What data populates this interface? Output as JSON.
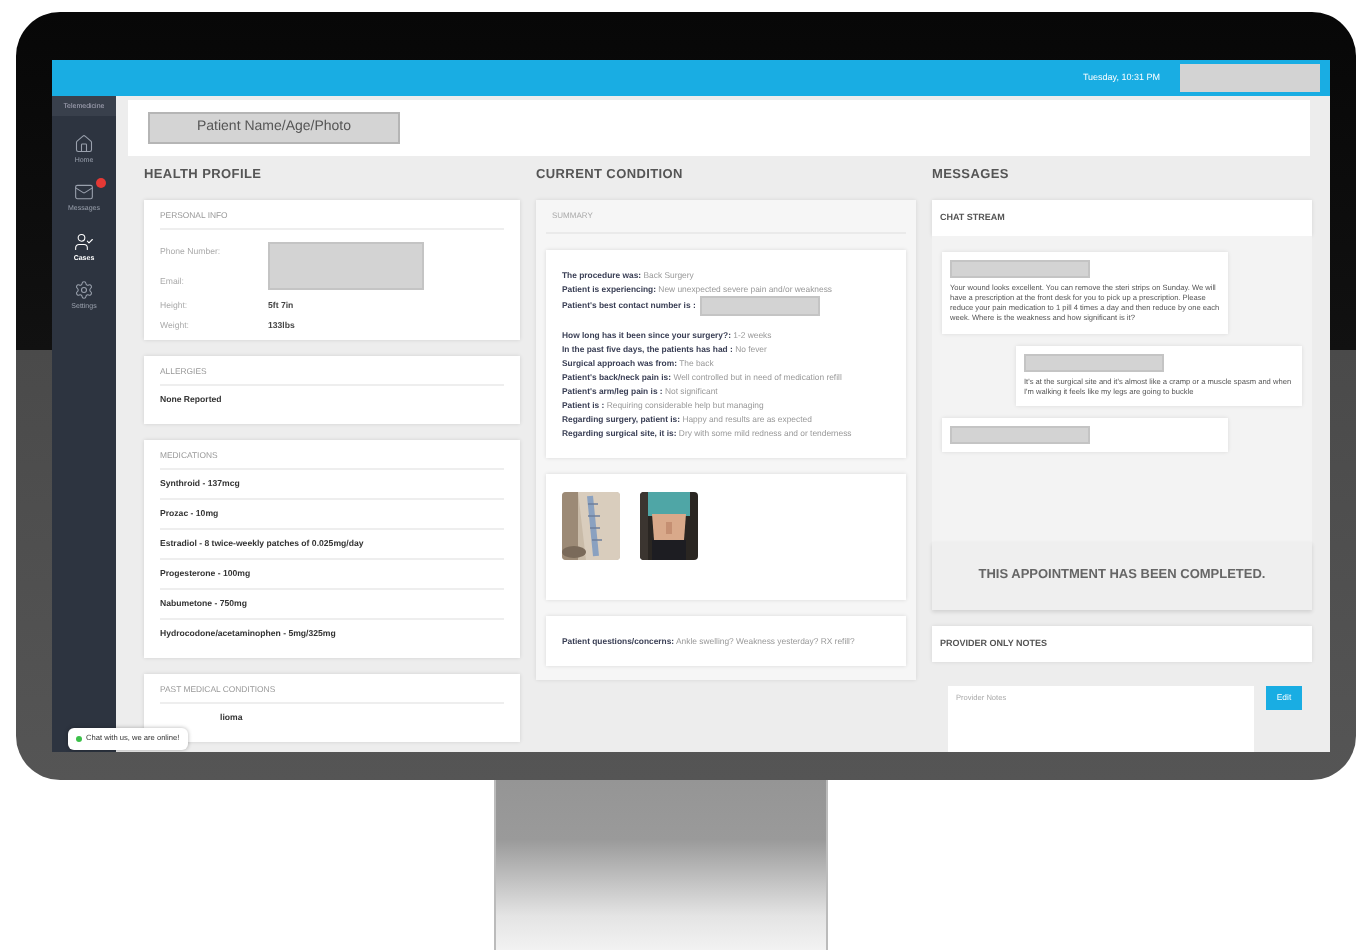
{
  "topbar": {
    "datetime": "Tuesday, 10:31 PM"
  },
  "sidebar": {
    "brand": "Telemedicine",
    "items": [
      {
        "label": "Home",
        "kind": "home",
        "selected": false,
        "alert": false
      },
      {
        "label": "Messages",
        "kind": "mail",
        "selected": false,
        "alert": true
      },
      {
        "label": "Cases",
        "kind": "user",
        "selected": true,
        "alert": false
      },
      {
        "label": "Settings",
        "kind": "gear",
        "selected": false,
        "alert": false
      }
    ]
  },
  "patient_header": {
    "label": "Patient Name/Age/Photo"
  },
  "health_profile": {
    "title": "HEALTH PROFILE",
    "personal_info": {
      "title": "PERSONAL INFO",
      "fields": [
        {
          "label": "Phone Number:"
        },
        {
          "label": "Email:"
        },
        {
          "label": "Height:",
          "value": "5ft 7in"
        },
        {
          "label": "Weight:",
          "value": "133lbs"
        }
      ]
    },
    "sections": [
      {
        "kind": "list",
        "title": "ALLERGIES",
        "items": [
          "None Reported"
        ]
      },
      {
        "kind": "list",
        "title": "MEDICATIONS",
        "items": [
          "Synthroid - 137mcg",
          "Prozac - 10mg",
          "Estradiol - 8 twice-weekly patches of 0.025mg/day",
          "Progesterone - 100mg",
          "Nabumetone - 750mg",
          "Hydrocodone/acetaminophen - 5mg/325mg"
        ]
      },
      {
        "kind": "covered",
        "title": "PAST MEDICAL CONDITIONS",
        "items": [
          "lioma"
        ]
      }
    ]
  },
  "current_condition": {
    "title": "CURRENT CONDITION",
    "summary_title": "SUMMARY",
    "lines": [
      {
        "text": "**The procedure was:** Back Surgery"
      },
      {
        "text": "**Patient is experiencing:** New unexpected severe pain and/or weakness"
      },
      {
        "text": "**Patient's best contact number is :**",
        "redacted": true
      },
      {
        "text": "**How long has it been since your surgery?:** 1-2 weeks"
      },
      {
        "text": "**In the past five days, the patients has had :** No fever"
      },
      {
        "text": "**Surgical approach was from:** The back"
      },
      {
        "text": "**Patient's back/neck pain is:** Well controlled but in need of medication refill"
      },
      {
        "text": "**Patient's arm/leg pain is :** Not significant"
      },
      {
        "text": "**Patient is :** Requiring considerable help but managing"
      },
      {
        "text": "**Regarding surgery, patient is:** Happy and results are as expected"
      },
      {
        "text": "**Regarding surgical site, it is:** Dry with some mild redness and or tenderness"
      }
    ],
    "concerns": "**Patient questions/concerns:** Ankle swelling? Weakness yesterday? RX refill?"
  },
  "messages": {
    "title": "MESSAGES",
    "stream_title": "CHAT STREAM",
    "items": [
      {
        "kind": "received",
        "text": "Your wound looks excellent. You can remove the steri strips on Sunday. We will have a prescription at the front desk for you to pick up a prescription. Please reduce your pain medication to 1 pill 4 times a day and then reduce by one each week. Where is the weakness and how significant is it?"
      },
      {
        "kind": "sent",
        "text": "It's at the surgical site and it's almost like a cramp or a muscle spasm and when I'm walking it feels like my legs are going to buckle"
      },
      {
        "kind": "received"
      }
    ],
    "banner": "THIS APPOINTMENT HAS BEEN COMPLETED.",
    "notes_title": "PROVIDER ONLY NOTES",
    "notes_placeholder": "Provider Notes",
    "edit_button": "Edit"
  },
  "chat_widget": {
    "text": "Chat with us, we are online!",
    "online": true
  }
}
